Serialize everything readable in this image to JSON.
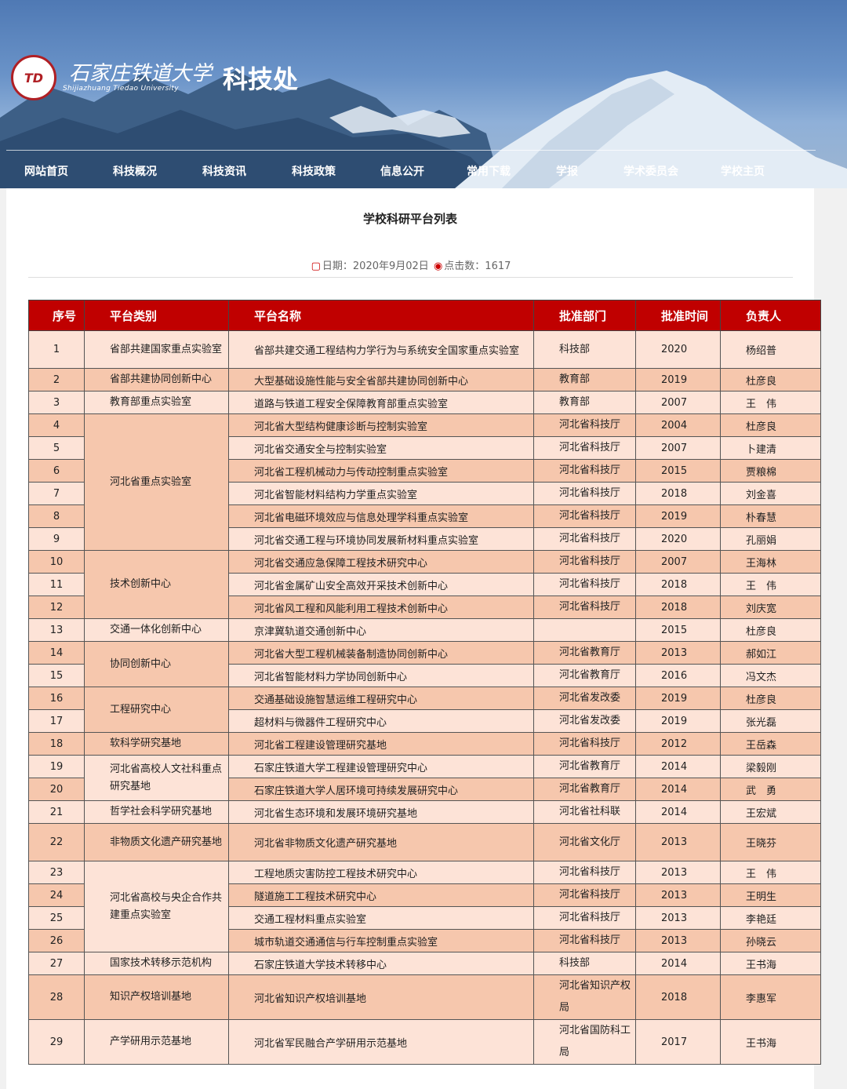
{
  "header": {
    "logo_text": "TD",
    "university_cn": "石家庄铁道大学",
    "university_en": "Shijiazhuang Tiedao University",
    "dept": "科技处"
  },
  "nav": [
    "网站首页",
    "科技概况",
    "科技资讯",
    "科技政策",
    "信息公开",
    "常用下载",
    "学报",
    "学术委员会",
    "学校主页"
  ],
  "article": {
    "title": "学校科研平台列表",
    "date_label": "日期：2020年9月02日",
    "views_label": "点击数：1617"
  },
  "table": {
    "headers": [
      "序号",
      "平台类别",
      "平台名称",
      "批准部门",
      "批准时间",
      "负责人"
    ],
    "rows": [
      [
        "1",
        "省部共建国家重点实验室",
        "省部共建交通工程结构力学行为与系统安全国家重点实验室",
        "科技部",
        "2020",
        "杨绍普"
      ],
      [
        "2",
        "省部共建协同创新中心",
        "大型基础设施性能与安全省部共建协同创新中心",
        "教育部",
        "2019",
        "杜彦良"
      ],
      [
        "3",
        "教育部重点实验室",
        "道路与铁道工程安全保障教育部重点实验室",
        "教育部",
        "2007",
        "王　伟"
      ],
      [
        "4",
        "河北省重点实验室",
        "河北省大型结构健康诊断与控制实验室",
        "河北省科技厅",
        "2004",
        "杜彦良"
      ],
      [
        "5",
        "",
        "河北省交通安全与控制实验室",
        "河北省科技厅",
        "2007",
        "卜建清"
      ],
      [
        "6",
        "",
        "河北省工程机械动力与传动控制重点实验室",
        "河北省科技厅",
        "2015",
        "贾粮棉"
      ],
      [
        "7",
        "",
        "河北省智能材料结构力学重点实验室",
        "河北省科技厅",
        "2018",
        "刘金喜"
      ],
      [
        "8",
        "",
        "河北省电磁环境效应与信息处理学科重点实验室",
        "河北省科技厅",
        "2019",
        "朴春慧"
      ],
      [
        "9",
        "",
        "河北省交通工程与环境协同发展新材料重点实验室",
        "河北省科技厅",
        "2020",
        "孔丽娟"
      ],
      [
        "10",
        "技术创新中心",
        "河北省交通应急保障工程技术研究中心",
        "河北省科技厅",
        "2007",
        "王海林"
      ],
      [
        "11",
        "",
        "河北省金属矿山安全高效开采技术创新中心",
        "河北省科技厅",
        "2018",
        "王　伟"
      ],
      [
        "12",
        "",
        "河北省风工程和风能利用工程技术创新中心",
        "河北省科技厅",
        "2018",
        "刘庆宽"
      ],
      [
        "13",
        "交通一体化创新中心",
        "京津冀轨道交通创新中心",
        "",
        "2015",
        "杜彦良"
      ],
      [
        "14",
        "协同创新中心",
        "河北省大型工程机械装备制造协同创新中心",
        "河北省教育厅",
        "2013",
        "郝如江"
      ],
      [
        "15",
        "",
        "河北省智能材料力学协同创新中心",
        "河北省教育厅",
        "2016",
        "冯文杰"
      ],
      [
        "16",
        "工程研究中心",
        "交通基础设施智慧运维工程研究中心",
        "河北省发改委",
        "2019",
        "杜彦良"
      ],
      [
        "17",
        "",
        "超材料与微器件工程研究中心",
        "河北省发改委",
        "2019",
        "张光磊"
      ],
      [
        "18",
        "软科学研究基地",
        "河北省工程建设管理研究基地",
        "河北省科技厅",
        "2012",
        "王岳森"
      ],
      [
        "19",
        "河北省高校人文社科重点研究基地",
        "石家庄铁道大学工程建设管理研究中心",
        "河北省教育厅",
        "2014",
        "梁毅刚"
      ],
      [
        "20",
        "",
        "石家庄铁道大学人居环境可持续发展研究中心",
        "河北省教育厅",
        "2014",
        "武　勇"
      ],
      [
        "21",
        "哲学社会科学研究基地",
        "河北省生态环境和发展环境研究基地",
        "河北省社科联",
        "2014",
        "王宏斌"
      ],
      [
        "22",
        "非物质文化遗产研究基地",
        "河北省非物质文化遗产研究基地",
        "河北省文化厅",
        "2013",
        "王晓芬"
      ],
      [
        "23",
        "河北省高校与央企合作共建重点实验室",
        "工程地质灾害防控工程技术研究中心",
        "河北省科技厅",
        "2013",
        "王　伟"
      ],
      [
        "24",
        "",
        "隧道施工工程技术研究中心",
        "河北省科技厅",
        "2013",
        "王明生"
      ],
      [
        "25",
        "",
        "交通工程材料重点实验室",
        "河北省科技厅",
        "2013",
        "李艳廷"
      ],
      [
        "26",
        "",
        "城市轨道交通通信与行车控制重点实验室",
        "河北省科技厅",
        "2013",
        "孙晓云"
      ],
      [
        "27",
        "国家技术转移示范机构",
        "石家庄铁道大学技术转移中心",
        "科技部",
        "2014",
        "王书海"
      ],
      [
        "28",
        "知识产权培训基地",
        "河北省知识产权培训基地",
        "河北省知识产权局",
        "2018",
        "李惠军"
      ],
      [
        "29",
        "产学研用示范基地",
        "河北省军民融合产学研用示范基地",
        "河北省国防科工局",
        "2017",
        "王书海"
      ]
    ]
  }
}
